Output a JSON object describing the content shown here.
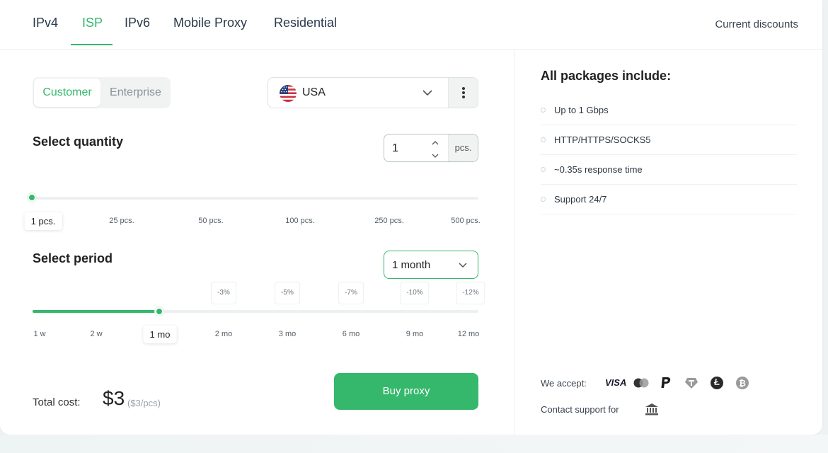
{
  "tabs": [
    {
      "label": "IPv4",
      "active": false
    },
    {
      "label": "ISP",
      "active": true
    },
    {
      "label": "IPv6",
      "active": false
    },
    {
      "label": "Mobile Proxy",
      "active": false
    },
    {
      "label": "Residential",
      "active": false
    }
  ],
  "current_discounts": "Current discounts",
  "customer_type": {
    "customer": "Customer",
    "enterprise": "Enterprise",
    "selected": "Customer"
  },
  "country": {
    "label": "USA",
    "flag_icon": "us-flag-icon"
  },
  "quantity": {
    "title": "Select quantity",
    "value": "1",
    "unit": "pcs.",
    "ticks": [
      "1 pcs.",
      "25 pcs.",
      "50 pcs.",
      "100 pcs.",
      "250 pcs.",
      "500 pcs."
    ],
    "selected_index": 0
  },
  "period": {
    "title": "Select period",
    "selected_label": "1 month",
    "ticks": [
      "1 w",
      "2 w",
      "1 mo",
      "2 mo",
      "3 mo",
      "6 mo",
      "9 mo",
      "12 mo"
    ],
    "selected_index": 2,
    "discounts": [
      "-3%",
      "-5%",
      "-7%",
      "-10%",
      "-12%"
    ]
  },
  "total": {
    "label": "Total cost:",
    "price": "$3",
    "per_unit": "($3/pcs)"
  },
  "buy_button": "Buy proxy",
  "packages": {
    "title": "All packages include:",
    "items": [
      "Up to 1 Gbps",
      "HTTP/HTTPS/SOCKS5",
      "~0.35s response time",
      "Support 24/7"
    ]
  },
  "payment": {
    "accept_label": "We accept:",
    "methods": [
      "visa-icon",
      "mastercard-icon",
      "paypal-icon",
      "tether-icon",
      "litecoin-icon",
      "bitcoin-icon"
    ],
    "visa_text": "VISA",
    "support_label": "Contact support for",
    "support_icon": "bank-icon"
  },
  "colors": {
    "accent": "#35b86c",
    "text": "#222222",
    "muted": "#8b9399"
  }
}
